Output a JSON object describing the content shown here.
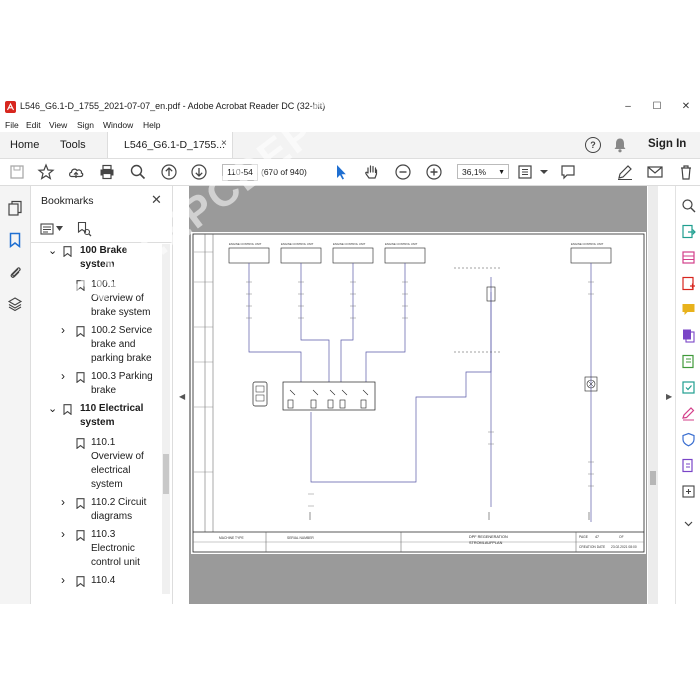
{
  "window": {
    "title": "L546_G6.1-D_1755_2021-07-07_en.pdf - Adobe Acrobat Reader DC (32-bit)",
    "minimize": "–",
    "maximize": "☐",
    "close": "✕"
  },
  "menu": [
    "File",
    "Edit",
    "View",
    "Sign",
    "Window",
    "Help"
  ],
  "tabs": {
    "home": "Home",
    "tools": "Tools",
    "document": "L546_G6.1-D_1755...",
    "close": "×"
  },
  "header": {
    "signin": "Sign In",
    "help": "?"
  },
  "toolbar": {
    "page_value": "110-54",
    "page_count": "(670 of 940)",
    "zoom_value": "36,1%"
  },
  "bookmarks": {
    "title": "Bookmarks",
    "close": "✕",
    "items": [
      {
        "label": "100 Brake system",
        "bold": true,
        "expander": "⌄"
      },
      {
        "label": "100.1 Overview of brake system",
        "bold": false,
        "expander": ""
      },
      {
        "label": "100.2 Service brake and parking brake",
        "bold": false,
        "expander": "›"
      },
      {
        "label": "100.3 Parking brake",
        "bold": false,
        "expander": "›"
      },
      {
        "label": "110 Electrical system",
        "bold": true,
        "expander": "⌄"
      },
      {
        "label": "110.1 Overview of electrical system",
        "bold": false,
        "expander": ""
      },
      {
        "label": "110.2 Circuit diagrams",
        "bold": false,
        "expander": "›"
      },
      {
        "label": "110.3 Electronic control unit",
        "bold": false,
        "expander": "›"
      },
      {
        "label": "110.4",
        "bold": false,
        "expander": "›"
      }
    ]
  },
  "diagram": {
    "ecu_title": "ENGINE CONTROL UNIT",
    "titleblock": {
      "machine_type": "MACHINE TYPE",
      "serial_number": "SERIAL NUMBER",
      "title_line1": "DPF REGENERATION",
      "title_line2": "STROMLAUFPLAN",
      "page_label": "PAGE",
      "page_value": "47",
      "of_label": "OF",
      "creation_label": "CREATION DATE",
      "creation_value": "23.02.2021 08:00"
    }
  },
  "watermark": "WWW.EPCDEPO.COM"
}
